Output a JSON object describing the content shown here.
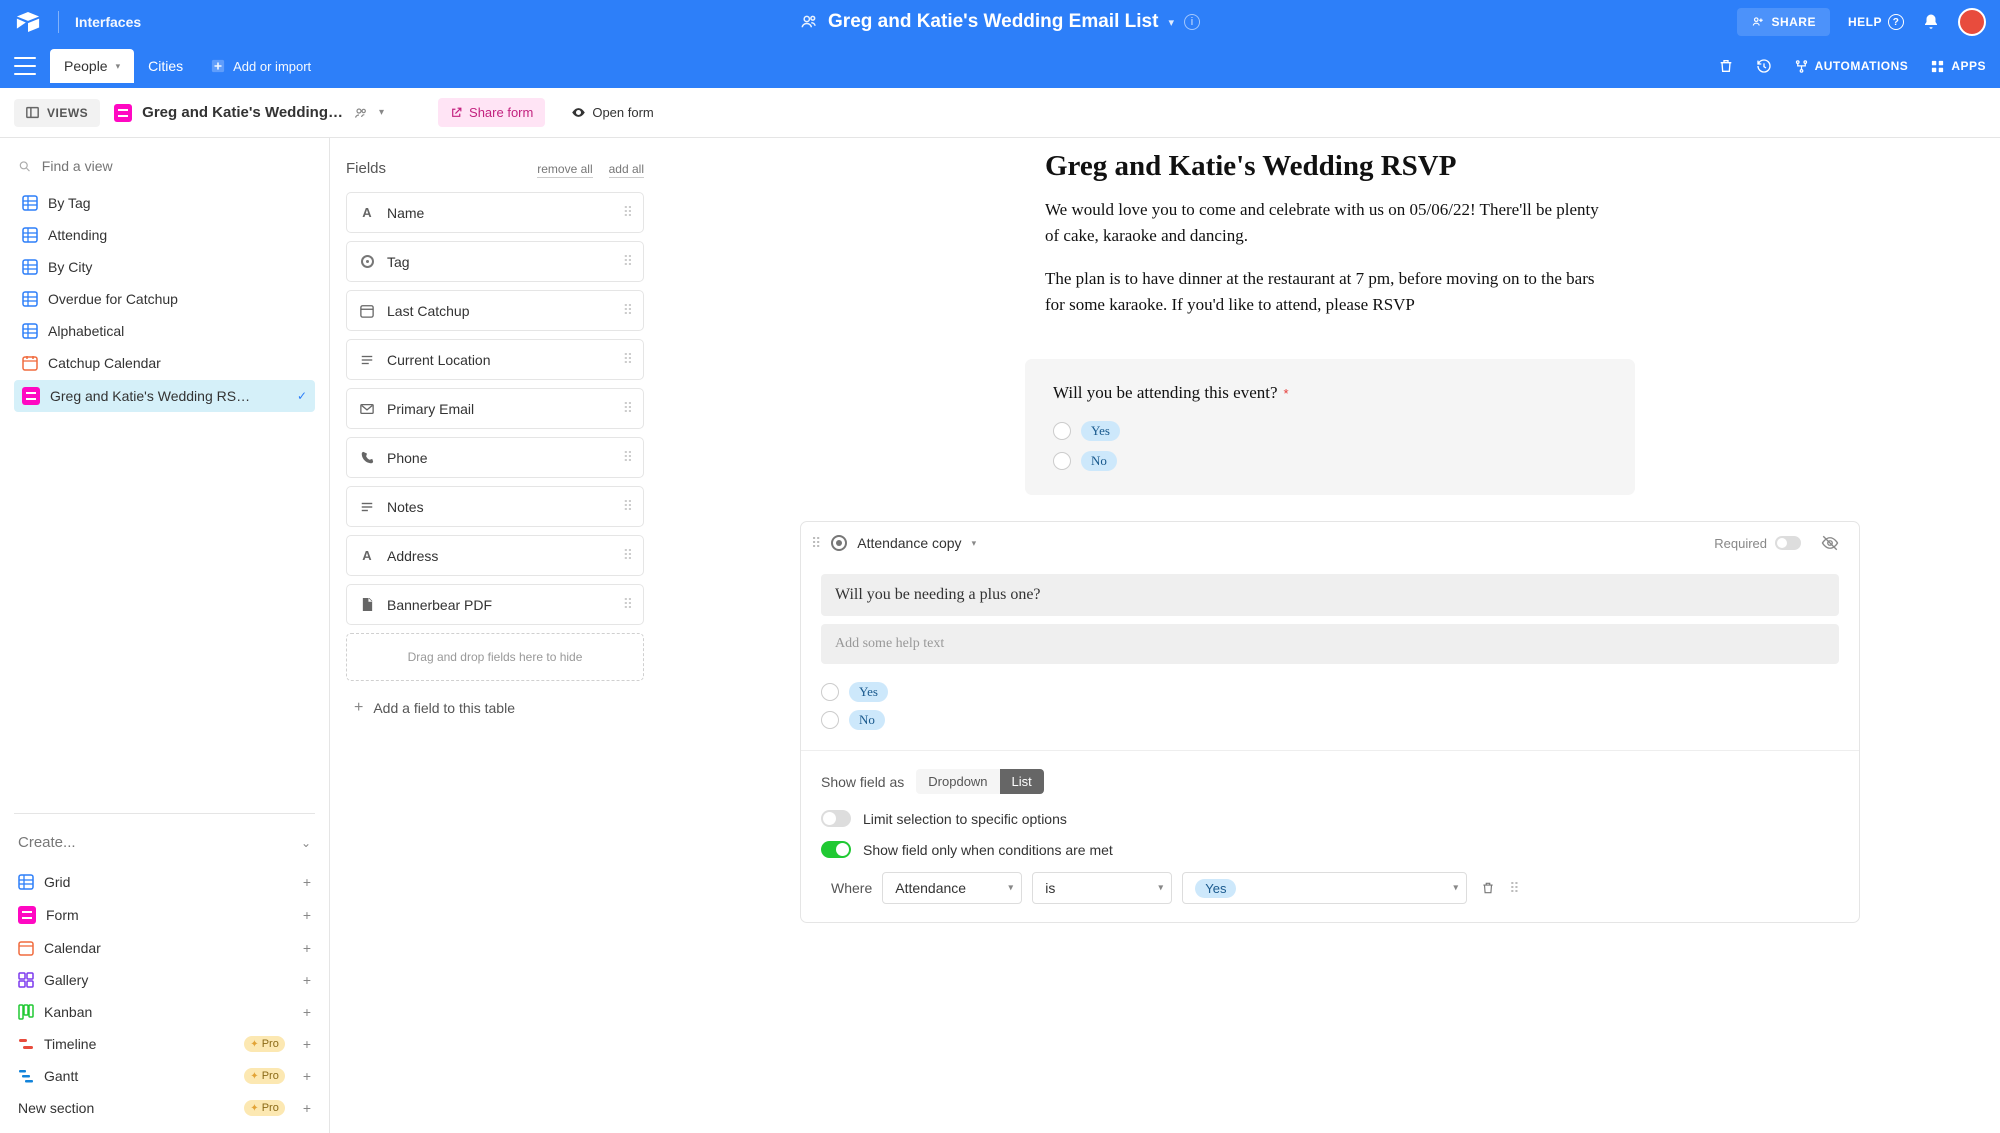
{
  "topbar": {
    "interfaces": "Interfaces",
    "title": "Greg and Katie's Wedding Email List",
    "share": "SHARE",
    "help": "HELP"
  },
  "tables": {
    "people": "People",
    "cities": "Cities",
    "add_import": "Add or import"
  },
  "tablebar_right": {
    "automations": "AUTOMATIONS",
    "apps": "APPS"
  },
  "toolbar": {
    "views": "VIEWS",
    "view_name": "Greg and Katie's Wedding…",
    "share_form": "Share form",
    "open_form": "Open form"
  },
  "sidebar": {
    "find_placeholder": "Find a view",
    "views": [
      "By Tag",
      "Attending",
      "By City",
      "Overdue for Catchup",
      "Alphabetical",
      "Catchup Calendar",
      "Greg and Katie's Wedding RS…"
    ],
    "create_header": "Create...",
    "create": {
      "grid": "Grid",
      "form": "Form",
      "calendar": "Calendar",
      "gallery": "Gallery",
      "kanban": "Kanban",
      "timeline": "Timeline",
      "gantt": "Gantt",
      "new_section": "New section",
      "pro": "Pro"
    }
  },
  "fields": {
    "header": "Fields",
    "remove_all": "remove all",
    "add_all": "add all",
    "items": [
      "Name",
      "Tag",
      "Last Catchup",
      "Current Location",
      "Primary Email",
      "Phone",
      "Notes",
      "Address",
      "Bannerbear PDF"
    ],
    "drop_hint": "Drag and drop fields here to hide",
    "add_field": "Add a field to this table"
  },
  "form": {
    "title": "Greg and Katie's Wedding RSVP",
    "desc1": "We would love you to come and celebrate with us on 05/06/22! There'll be plenty of cake, karaoke and dancing.",
    "desc2": "The plan is to have dinner at the restaurant at 7 pm, before moving on to the bars for some karaoke. If you'd like to attend, please RSVP",
    "q1": "Will you be attending this event?",
    "yes": "Yes",
    "no": "No"
  },
  "editor": {
    "field_name": "Attendance copy",
    "required_label": "Required",
    "question_value": "Will you be needing a plus one?",
    "help_placeholder": "Add some help text",
    "yes": "Yes",
    "no": "No",
    "show_field_as": "Show field as",
    "dropdown": "Dropdown",
    "list": "List",
    "limit_selection": "Limit selection to specific options",
    "show_conditions": "Show field only when conditions are met",
    "where": "Where",
    "cond_field": "Attendance",
    "cond_op": "is",
    "cond_value": "Yes"
  }
}
